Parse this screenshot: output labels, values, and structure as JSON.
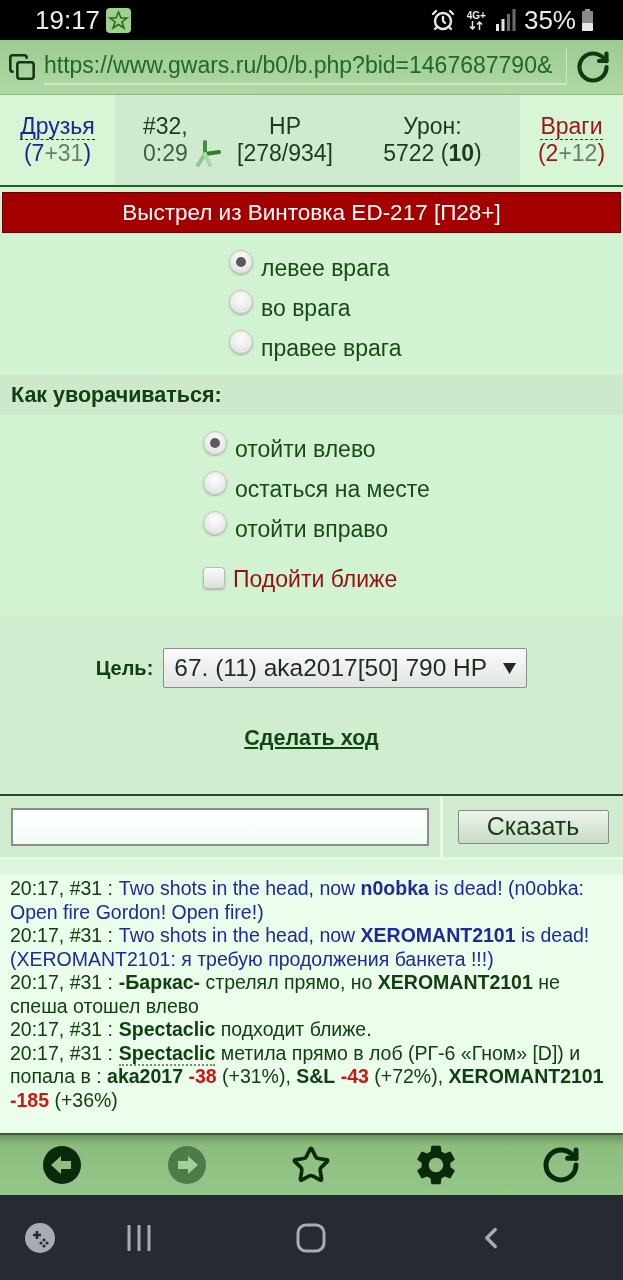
{
  "status_bar": {
    "time": "19:17",
    "network": "4G+",
    "battery": "35%"
  },
  "address_bar": {
    "url": "https://www.gwars.ru/b0/b.php?bid=1467687790&"
  },
  "battle_header": {
    "friends": {
      "label": "Друзья",
      "count": [
        {
          "text": "(7",
          "kind": "own"
        },
        {
          "text": "+31",
          "kind": "extra"
        },
        {
          "text": ")",
          "kind": "own"
        }
      ]
    },
    "turn": {
      "number": "#32,",
      "timer": "0:29"
    },
    "hp": {
      "label": "HP",
      "value": "[278/934]"
    },
    "damage": {
      "label": "Урон:",
      "value": "5722 (**10**)"
    },
    "enemies": {
      "label": "Враги",
      "count": [
        {
          "text": "(2",
          "kind": "own"
        },
        {
          "text": "+12",
          "kind": "extra"
        },
        {
          "text": ")",
          "kind": "own"
        }
      ]
    }
  },
  "action_banner": "Выстрел из Винтовка ED-217 [П28+]",
  "aim_options": [
    {
      "label": "левее врага",
      "selected": true
    },
    {
      "label": "во врага",
      "selected": false
    },
    {
      "label": "правее врага",
      "selected": false
    }
  ],
  "dodge": {
    "title": "Как уворачиваться:",
    "options": [
      {
        "label": "отойти влево",
        "selected": true
      },
      {
        "label": "остаться на месте",
        "selected": false
      },
      {
        "label": "отойти вправо",
        "selected": false
      }
    ],
    "approach": {
      "label": "Подойти ближе",
      "checked": false
    }
  },
  "target": {
    "label": "Цель:",
    "value": "67. (11) aka2017[50] 790 HP"
  },
  "submit_link": "Сделать ход",
  "chat": {
    "button": "Сказать"
  },
  "battle_log": [
    {
      "time": "20:17, #31 :",
      "kind": "system",
      "parts": [
        {
          "kind": "text",
          "text": "Two shots in the head, now **n0obka** is dead! (n0obka: Open fire Gordon! Open fire!)"
        }
      ]
    },
    {
      "time": "20:17, #31 :",
      "kind": "system",
      "parts": [
        {
          "kind": "text",
          "text": "Two shots in the head, now **XEROMANT2101** is dead! (XEROMANT2101: я требую продолжения банкета !!!)"
        }
      ]
    },
    {
      "time": "20:17, #31 :",
      "kind": "action",
      "parts": [
        {
          "kind": "text",
          "text": "**-Баркас-** стрелял прямо, но **XEROMANT2101** не спеша отошел влево"
        }
      ]
    },
    {
      "time": "20:17, #31 :",
      "kind": "action",
      "parts": [
        {
          "kind": "text",
          "text": "**Spectaclic** подходит ближе."
        }
      ]
    },
    {
      "time": "20:17, #31 :",
      "kind": "action",
      "parts": [
        {
          "kind": "link",
          "text": "Spectaclic"
        },
        {
          "kind": "text",
          "text": " метила прямо в лоб (РГ-6 «Гном» [D]) и попала в : **aka2017** "
        },
        {
          "kind": "damage",
          "text": "-38"
        },
        {
          "kind": "text",
          "text": " (+31%), **S&L** "
        },
        {
          "kind": "damage",
          "text": "-43"
        },
        {
          "kind": "text",
          "text": " (+72%), **XEROMANT2101** "
        },
        {
          "kind": "damage",
          "text": "-185"
        },
        {
          "kind": "text",
          "text": " (+36%)"
        }
      ]
    }
  ],
  "browser_toolbar": [
    {
      "kind": "back",
      "disabled": false
    },
    {
      "kind": "forward",
      "disabled": true
    },
    {
      "kind": "bookmark",
      "disabled": false
    },
    {
      "kind": "settings",
      "disabled": false
    },
    {
      "kind": "reload",
      "disabled": false
    }
  ]
}
